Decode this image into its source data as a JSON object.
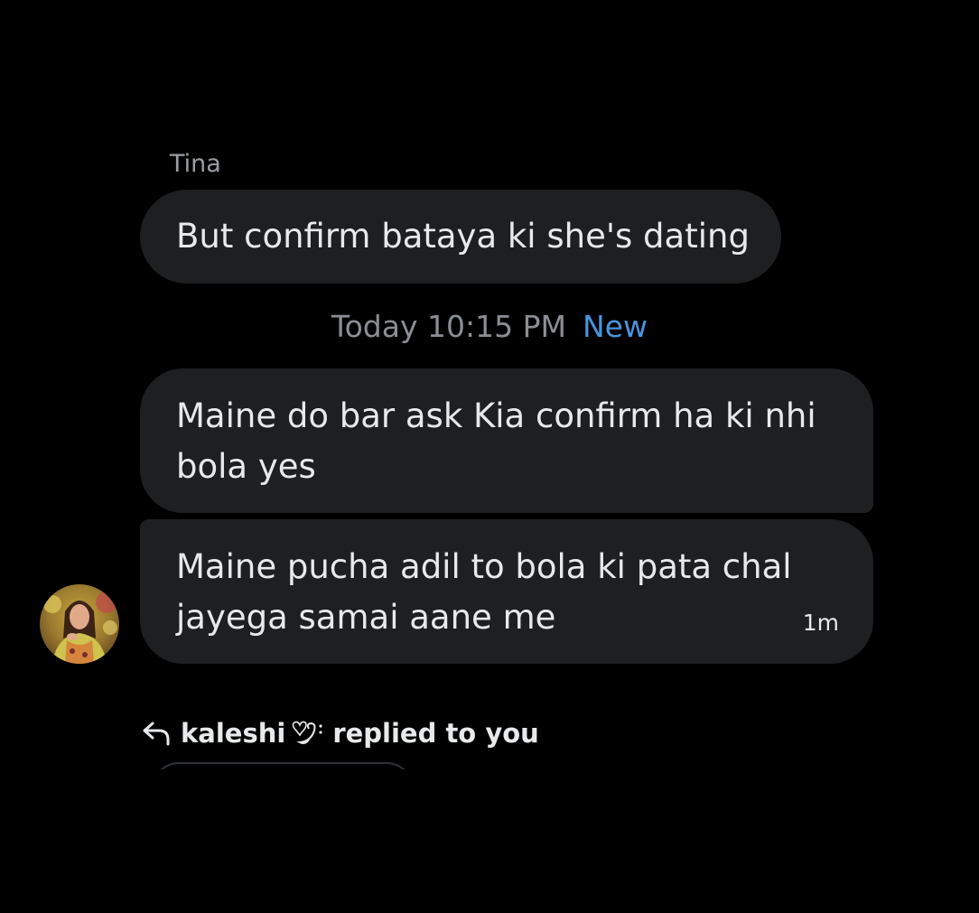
{
  "conversation": {
    "messages": [
      {
        "sender": "Tina",
        "text": "But confirm bataya ki she's dating"
      },
      {
        "text": "Maine do bar ask Kia confirm ha ki nhi bola yes"
      },
      {
        "text": "Maine pucha adil to bola ki pata chal jayega samai aane me",
        "time": "1m"
      }
    ],
    "divider": {
      "time": "Today 10:15 PM",
      "badge": "New"
    },
    "reply_notice": {
      "user": "kaleshi",
      "suffix": "replied to you"
    }
  },
  "colors": {
    "background": "#000000",
    "bubble": "#1e1f21",
    "text": "#e7e9ea",
    "muted": "#8b8f94",
    "accent": "#4a93dd"
  },
  "icons": {
    "reply": "reply-arrow-icon",
    "name_decoration": "heart-swirl-icon"
  }
}
